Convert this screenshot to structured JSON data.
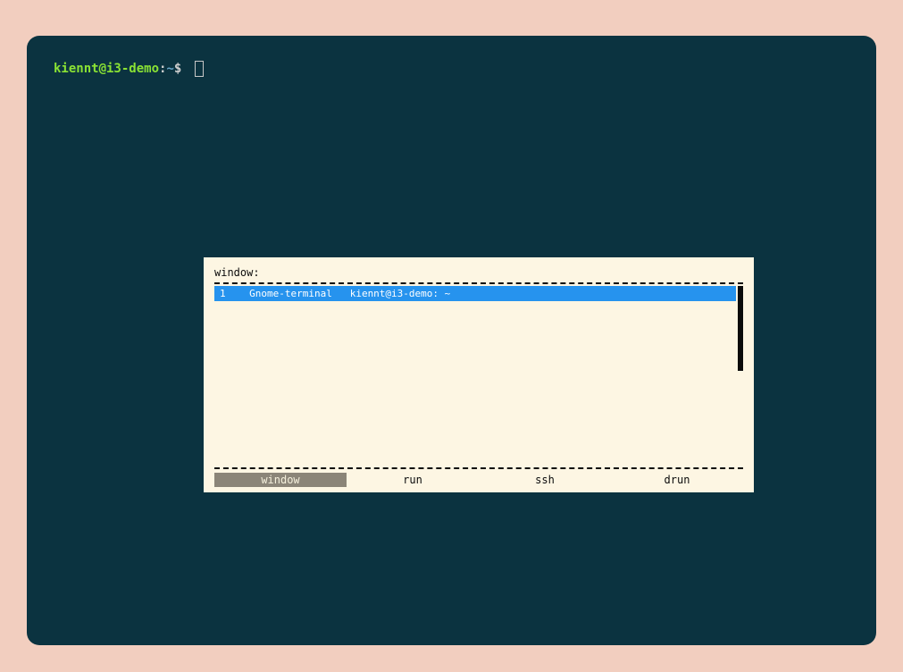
{
  "terminal": {
    "user_host": "kiennt@i3-demo",
    "sep1": ":",
    "path": "~",
    "dollar": "$ "
  },
  "rofi": {
    "prompt_label": "window:",
    "input_value": "",
    "items": [
      {
        "index": "1",
        "app": "Gnome-terminal",
        "title": "kiennt@i3-demo: ~",
        "selected": true
      }
    ],
    "modes": [
      {
        "label": "window",
        "active": true
      },
      {
        "label": "run",
        "active": false
      },
      {
        "label": "ssh",
        "active": false
      },
      {
        "label": "drun",
        "active": false
      }
    ]
  }
}
